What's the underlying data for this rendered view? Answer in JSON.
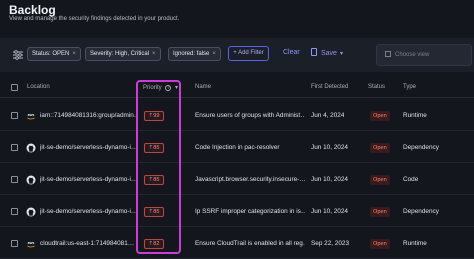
{
  "header": {
    "title": "Backlog",
    "subtitle": "View and manage the security findings detected in your product."
  },
  "filters": {
    "chips": [
      {
        "label": "Status: OPEN",
        "remove": "×"
      },
      {
        "label": "Severity: High, Critical",
        "remove": "×"
      },
      {
        "label": "Ignored: false",
        "remove": "×"
      }
    ],
    "add_filter": "+ Add Filter",
    "clear": "Clear",
    "save": "Save",
    "choose_view": "Choose view"
  },
  "table": {
    "columns": {
      "location": "Location",
      "priority": "Priority",
      "name": "Name",
      "first_detected": "First Detected",
      "status": "Status",
      "type": "Type"
    },
    "rows": [
      {
        "icon": "aws-icon",
        "location": "iam::714984081316:group/admin…",
        "priority": "⇡99",
        "name": "Ensure users of groups with Administ…",
        "first_detected": "Jun 4, 2024",
        "status": "Open",
        "type": "Runtime"
      },
      {
        "icon": "github-icon",
        "location": "jit-se-demo/serverless-dynamo-i…",
        "priority": "⇡85",
        "name": "Code Injection in pac-resolver",
        "first_detected": "Jun 10, 2024",
        "status": "Open",
        "type": "Dependency"
      },
      {
        "icon": "github-icon",
        "location": "jit-se-demo/serverless-dynamo-i…",
        "priority": "⇡85",
        "name": "Javascript.browser.security.insecure-…",
        "first_detected": "Jun 10, 2024",
        "status": "Open",
        "type": "Code"
      },
      {
        "icon": "github-icon",
        "location": "jit-se-demo/serverless-dynamo-i…",
        "priority": "⇡85",
        "name": "Ip SSRF improper categorization in is…",
        "first_detected": "Jun 10, 2024",
        "status": "Open",
        "type": "Dependency"
      },
      {
        "icon": "aws-icon",
        "location": "cloudtrail:us-east-1:714984081…",
        "priority": "⇡82",
        "name": "Ensure CloudTrail is enabled in all reg…",
        "first_detected": "Sep 22, 2023",
        "status": "Open",
        "type": "Runtime"
      }
    ]
  },
  "colors": {
    "background": "#13161d",
    "accent": "#8f95ff",
    "priority_red": "#c0453f",
    "status_open": "#ff7a70",
    "highlight": "#c93ed6"
  }
}
